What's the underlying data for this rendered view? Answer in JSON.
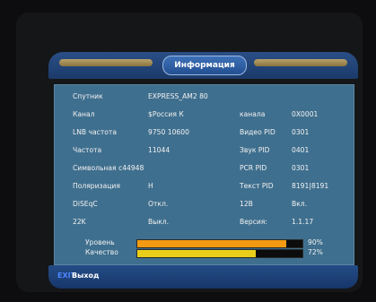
{
  "dialog": {
    "title": "Информация",
    "rows": [
      {
        "l1": "Спутник",
        "v1": "EXPRESS_AM2 80"
      },
      {
        "l1": "Канал",
        "v1": "$Россия К",
        "l2": "канала",
        "v2": "0X0001"
      },
      {
        "l1": "LNB частота",
        "v1": "9750 10600",
        "l2": "Видео PID",
        "v2": "0301"
      },
      {
        "l1": "Частота",
        "v1": "11044",
        "l2": "Звук PID",
        "v2": "0401"
      },
      {
        "l1": "Символьная с44948",
        "v1": "",
        "l2": "PCR PID",
        "v2": "0301"
      },
      {
        "l1": "Поляризация",
        "v1": "H",
        "l2": "Текст PID",
        "v2": "8191|8191"
      },
      {
        "l1": "DiSEqC",
        "v1": "Откл.",
        "l2": "12В",
        "v2": "Вкл."
      },
      {
        "l1": "22K",
        "v1": "Выкл.",
        "l2": "Версия:",
        "v2": "1.1.17"
      }
    ],
    "signal": [
      {
        "label": "Уровень",
        "value": 90,
        "text": "90%",
        "color": "#f39a12"
      },
      {
        "label": "Качество",
        "value": 72,
        "text": "72%",
        "color": "#e9cf1a"
      }
    ]
  },
  "footer": {
    "key": "EXIT",
    "label": "Выход"
  }
}
